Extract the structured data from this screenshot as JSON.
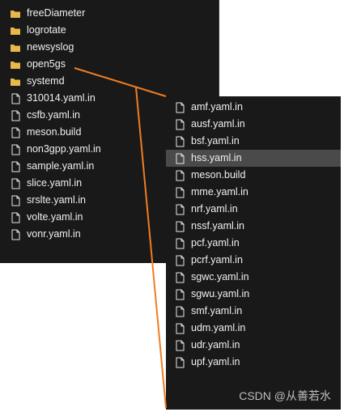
{
  "left_panel": {
    "items": [
      {
        "type": "folder",
        "label": "freeDiameter"
      },
      {
        "type": "folder",
        "label": "logrotate"
      },
      {
        "type": "folder",
        "label": "newsyslog"
      },
      {
        "type": "folder",
        "label": "open5gs"
      },
      {
        "type": "folder",
        "label": "systemd"
      },
      {
        "type": "file",
        "label": "310014.yaml.in"
      },
      {
        "type": "file",
        "label": "csfb.yaml.in"
      },
      {
        "type": "file",
        "label": "meson.build"
      },
      {
        "type": "file",
        "label": "non3gpp.yaml.in"
      },
      {
        "type": "file",
        "label": "sample.yaml.in"
      },
      {
        "type": "file",
        "label": "slice.yaml.in"
      },
      {
        "type": "file",
        "label": "srslte.yaml.in"
      },
      {
        "type": "file",
        "label": "volte.yaml.in"
      },
      {
        "type": "file",
        "label": "vonr.yaml.in"
      }
    ]
  },
  "right_panel": {
    "items": [
      {
        "type": "file",
        "label": "amf.yaml.in"
      },
      {
        "type": "file",
        "label": "ausf.yaml.in"
      },
      {
        "type": "file",
        "label": "bsf.yaml.in"
      },
      {
        "type": "file",
        "label": "hss.yaml.in",
        "selected": true
      },
      {
        "type": "file",
        "label": "meson.build"
      },
      {
        "type": "file",
        "label": "mme.yaml.in"
      },
      {
        "type": "file",
        "label": "nrf.yaml.in"
      },
      {
        "type": "file",
        "label": "nssf.yaml.in"
      },
      {
        "type": "file",
        "label": "pcf.yaml.in"
      },
      {
        "type": "file",
        "label": "pcrf.yaml.in"
      },
      {
        "type": "file",
        "label": "sgwc.yaml.in"
      },
      {
        "type": "file",
        "label": "sgwu.yaml.in"
      },
      {
        "type": "file",
        "label": "smf.yaml.in"
      },
      {
        "type": "file",
        "label": "udm.yaml.in"
      },
      {
        "type": "file",
        "label": "udr.yaml.in"
      },
      {
        "type": "file",
        "label": "upf.yaml.in"
      }
    ]
  },
  "watermark": "CSDN @从善若水",
  "colors": {
    "panel_bg": "#191919",
    "text": "#f0f0f0",
    "selected_bg": "#4a4a4a",
    "folder": "#e8b84a",
    "annotation_line": "#f07d22"
  }
}
